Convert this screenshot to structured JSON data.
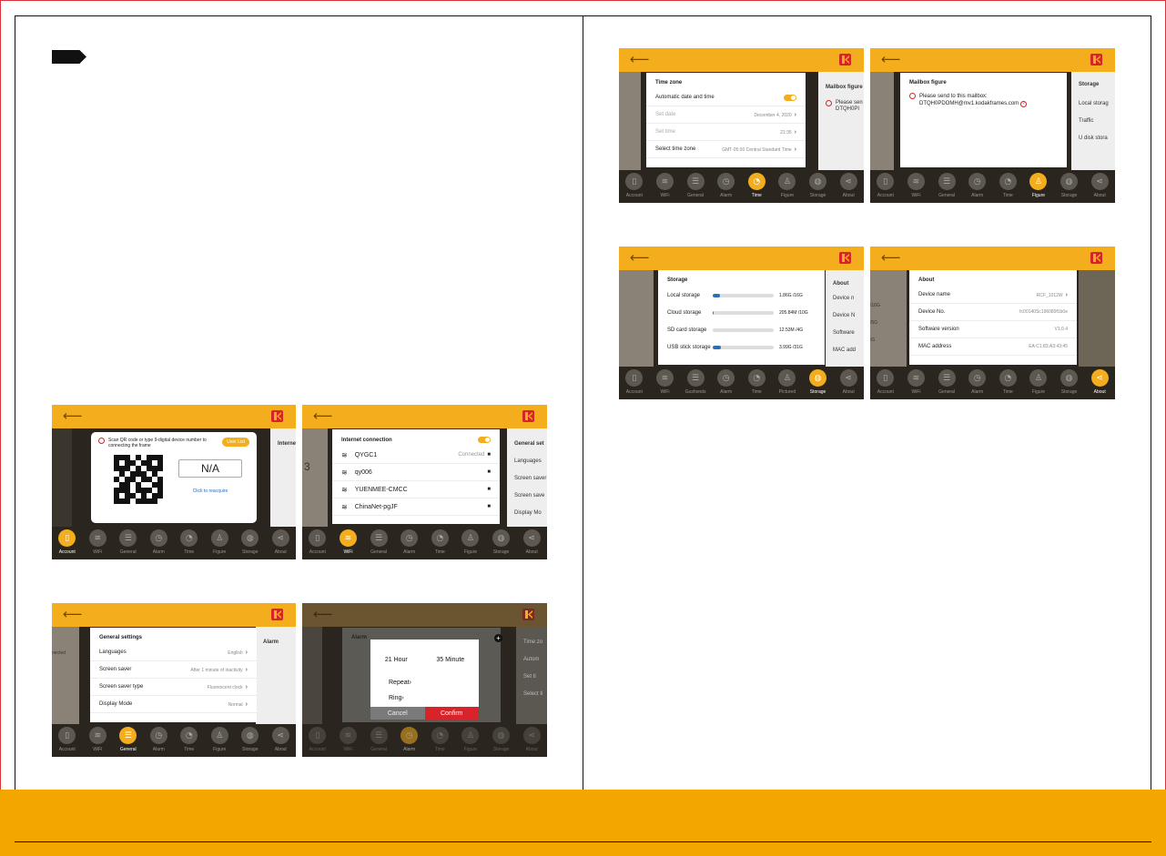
{
  "colors": {
    "accent": "#f3ad1d",
    "brand_red": "#d8232a",
    "band": "#f3a500"
  },
  "nav_items": [
    "Account",
    "WiFi",
    "General",
    "Alarm",
    "Time",
    "Figure",
    "Storage",
    "About"
  ],
  "nav_items_storage_shot": [
    "Account",
    "WiFi",
    "Gushonds",
    "Alarm",
    "Time",
    "Pictured",
    "Storage",
    "About"
  ],
  "icons": {
    "back": "back-arrow-icon",
    "logo": "kodak-logo-icon",
    "chevron": "chevron-right-icon",
    "wifi": "wifi-icon",
    "lock": "lock-icon",
    "help": "question-icon"
  },
  "account": {
    "prompt": "Scan QR code or type 9-digital device number to connecting the frame",
    "user_list": "User List",
    "device_number": "N/A",
    "reacquire": "Click to reacquire",
    "right_title": "Internet",
    "right_items": [
      "Q",
      "Y",
      "q",
      "B"
    ]
  },
  "wifi": {
    "title": "Internet connection",
    "left_value": "3",
    "networks": [
      {
        "name": "QYGC1",
        "status": "Connected"
      },
      {
        "name": "qy006",
        "status": ""
      },
      {
        "name": "YUENMEE-CMCC",
        "status": ""
      },
      {
        "name": "ChinaNet-pgJF",
        "status": ""
      }
    ],
    "right_title": "General set",
    "right_items": [
      "Languages",
      "Screen saver",
      "Screen save",
      "Display Mo"
    ]
  },
  "general": {
    "title": "General settings",
    "left_value": "nected",
    "rows": [
      {
        "label": "Languages",
        "value": "English"
      },
      {
        "label": "Screen saver",
        "value": "After 1 minute of inactivity"
      },
      {
        "label": "Screen saver type",
        "value": "Fluorescent clock"
      },
      {
        "label": "Display Mode",
        "value": "Normal"
      }
    ],
    "right_title": "Alarm"
  },
  "alarm": {
    "title": "Alarm",
    "hour": "21",
    "hour_unit": "Hour",
    "minute": "35",
    "minute_unit": "Minute",
    "repeat": "Repeat",
    "ring": "Ring",
    "cancel": "Cancel",
    "confirm": "Confirm",
    "right_items": [
      "Time zo",
      "Autom",
      "",
      "Set ti",
      "Select ti"
    ]
  },
  "time": {
    "title": "Time zone",
    "rows": [
      {
        "label": "Automatic date and time",
        "value": ""
      },
      {
        "label": "Set date",
        "value": "December 4, 2020"
      },
      {
        "label": "Set time",
        "value": "21:35"
      },
      {
        "label": "Select time zone",
        "value": "GMT-05:00 Central Standard Time"
      }
    ],
    "right_title": "Mailbox figure",
    "right_lines": [
      "Please sen",
      "DTQH0PI"
    ]
  },
  "figure": {
    "title": "Mailbox figure",
    "line1": "Please send to this mailbox:",
    "line2": "DTQH0PDOMH@mv1.kodakframes.com",
    "right_title": "Storage",
    "right_items": [
      "Local storag",
      "Traffic",
      "U disk stora"
    ]
  },
  "storage": {
    "title": "Storage",
    "rows": [
      {
        "label": "Local storage",
        "value": "1.86G /16G",
        "fill": 0.12
      },
      {
        "label": "Cloud storage",
        "value": "205.84M /10G",
        "fill": 0.02
      },
      {
        "label": "SD card storage",
        "value": "12.53M /4G",
        "fill": 0.0
      },
      {
        "label": "USB stick storage",
        "value": "3.99G /31G",
        "fill": 0.13
      }
    ],
    "right_title": "About",
    "right_items": [
      "Device n",
      "Device N",
      "Software",
      "MAC add"
    ]
  },
  "about": {
    "title": "About",
    "left_items": [
      "/16G",
      "/5G",
      "/G"
    ],
    "rows": [
      {
        "label": "Device name",
        "value": "RCF_1012W"
      },
      {
        "label": "Device No.",
        "value": "fc00140Sc196089f1b0e"
      },
      {
        "label": "Software version",
        "value": "V1.0.4"
      },
      {
        "label": "MAC address",
        "value": "EA:C1:83:A3:43:45"
      }
    ]
  }
}
